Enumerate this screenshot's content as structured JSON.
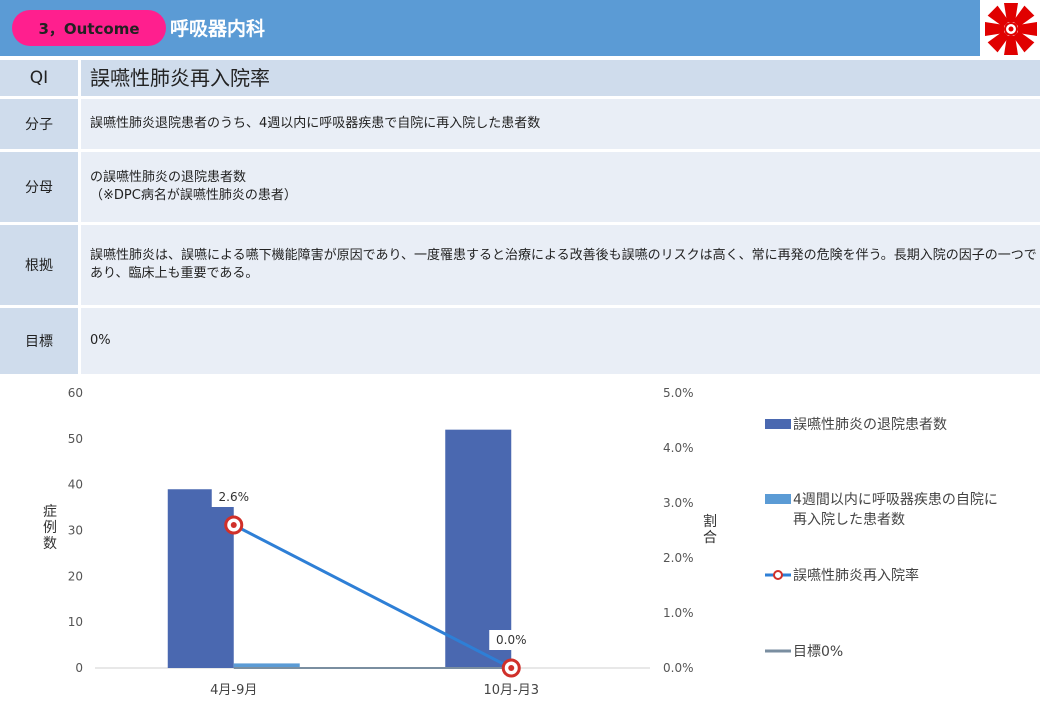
{
  "header": {
    "badge": "3，Outcome",
    "department": "呼吸器内科",
    "logo": "hospital-emblem"
  },
  "qi": {
    "label": "QI",
    "title": "誤嚥性肺炎再入院率",
    "rows": [
      {
        "label": "分子",
        "text": "誤嚥性肺炎退院患者のうち、4週以内に呼吸器疾患で自院に再入院した患者数"
      },
      {
        "label": "分母",
        "text": "の誤嚥性肺炎の退院患者数\n（※DPC病名が誤嚥性肺炎の患者）"
      },
      {
        "label": "根拠",
        "text": "誤嚥性肺炎は、誤嚥による嚥下機能障害が原因であり、一度罹患すると治療による改善後も誤嚥のリスクは高く、常に再発の危険を伴う。長期入院の因子の一つであり、臨床上も重要である。"
      },
      {
        "label": "目標",
        "text": "0%"
      }
    ]
  },
  "chart_data": {
    "type": "bar",
    "categories": [
      "4月-9月",
      "10月-月3"
    ],
    "series": [
      {
        "name": "誤嚥性肺炎の退院患者数",
        "kind": "bar",
        "axis": "left",
        "color": "#4a68b0",
        "values": [
          39,
          52
        ]
      },
      {
        "name": "4週間以内に呼吸器疾患の自院に再入院した患者数",
        "kind": "bar",
        "axis": "left",
        "color": "#5b9bd5",
        "values": [
          1,
          0
        ]
      },
      {
        "name": "誤嚥性肺炎再入院率",
        "kind": "line",
        "axis": "right",
        "color": "#2e7fd6",
        "values": [
          0.026,
          0.0
        ],
        "labels": [
          "2.6%",
          "0.0%"
        ]
      },
      {
        "name": "目標0%",
        "kind": "line",
        "axis": "right",
        "color": "#7a8ea0",
        "values": [
          0,
          0
        ]
      }
    ],
    "legend_labels": [
      "誤嚥性肺炎の退院患者数",
      "4週間以内に呼吸器疾患の自院に\n再入院した患者数",
      "誤嚥性肺炎再入院率",
      "目標0%"
    ],
    "ylabel": "症例数",
    "y2label": "割合",
    "ylim": [
      0,
      60
    ],
    "y2lim": [
      0,
      0.05
    ],
    "yticks": [
      "0",
      "10",
      "20",
      "30",
      "40",
      "50",
      "60"
    ],
    "y2ticks": [
      "0.0%",
      "1.0%",
      "2.0%",
      "3.0%",
      "4.0%",
      "5.0%"
    ],
    "legend_position": "right",
    "grid": false
  }
}
